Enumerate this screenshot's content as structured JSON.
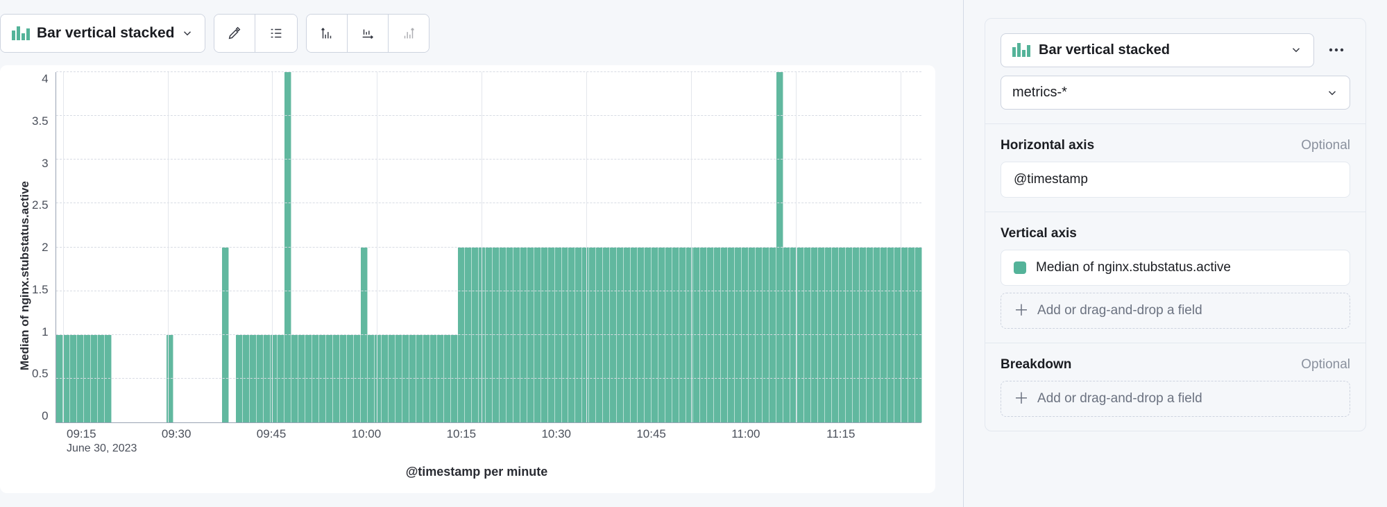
{
  "toolbar": {
    "chart_type_label": "Bar vertical stacked"
  },
  "chart_data": {
    "type": "bar",
    "title": "",
    "xlabel": "@timestamp per minute",
    "ylabel": "Median of nginx.stubstatus.active",
    "ylim": [
      0,
      4
    ],
    "y_ticks": [
      "4",
      "3.5",
      "3",
      "2.5",
      "2",
      "1.5",
      "1",
      "0.5",
      "0"
    ],
    "x_tick_labels": [
      "09:15",
      "09:30",
      "09:45",
      "10:00",
      "10:15",
      "10:30",
      "10:45",
      "11:00",
      "11:15"
    ],
    "x_date_label": "June 30, 2023",
    "x_start_minute": 554,
    "x_end_minute": 678,
    "values": [
      1,
      1,
      1,
      1,
      1,
      1,
      1,
      1,
      0,
      0,
      0,
      0,
      0,
      0,
      0,
      0,
      1,
      0,
      0,
      0,
      0,
      0,
      0,
      0,
      2,
      0,
      1,
      1,
      1,
      1,
      1,
      1,
      1,
      4,
      1,
      1,
      1,
      1,
      1,
      1,
      1,
      1,
      1,
      1,
      2,
      1,
      1,
      1,
      1,
      1,
      1,
      1,
      1,
      1,
      1,
      1,
      1,
      1,
      2,
      2,
      2,
      2,
      2,
      2,
      2,
      2,
      2,
      2,
      2,
      2,
      2,
      2,
      2,
      2,
      2,
      2,
      2,
      2,
      2,
      2,
      2,
      2,
      2,
      2,
      2,
      2,
      2,
      2,
      2,
      2,
      2,
      2,
      2,
      2,
      2,
      2,
      2,
      2,
      2,
      2,
      2,
      2,
      2,
      2,
      4,
      2,
      2,
      2,
      2,
      2,
      2,
      2,
      2,
      2,
      2,
      2,
      2,
      2,
      2,
      2,
      2,
      2,
      2,
      2,
      2
    ]
  },
  "config": {
    "chart_type_label": "Bar vertical stacked",
    "index_pattern": "metrics-*",
    "horizontal_axis": {
      "title": "Horizontal axis",
      "optional": "Optional",
      "field": "@timestamp"
    },
    "vertical_axis": {
      "title": "Vertical axis",
      "field": "Median of nginx.stubstatus.active",
      "add_hint": "Add or drag-and-drop a field"
    },
    "breakdown": {
      "title": "Breakdown",
      "optional": "Optional",
      "add_hint": "Add or drag-and-drop a field"
    }
  }
}
